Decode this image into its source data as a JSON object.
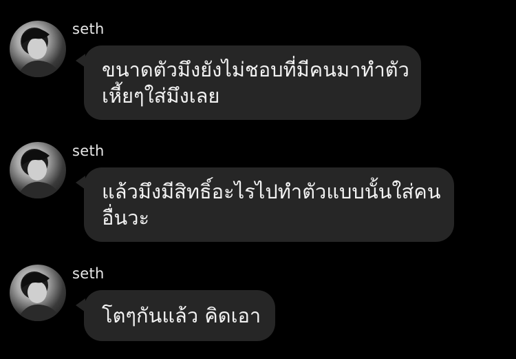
{
  "messages": [
    {
      "sender": "seth",
      "lines": [
        "ขนาดตัวมึงยังไม่ชอบที่มีคนมาทำตัว",
        "เหี้ยๆใส่มึงเลย"
      ]
    },
    {
      "sender": "seth",
      "lines": [
        "แล้วมึงมีสิทธิ์อะไรไปทำตัวแบบนั้นใส่คน",
        "อื่นวะ"
      ]
    },
    {
      "sender": "seth",
      "lines": [
        "โตๆกันแล้ว คิดเอา"
      ]
    }
  ]
}
